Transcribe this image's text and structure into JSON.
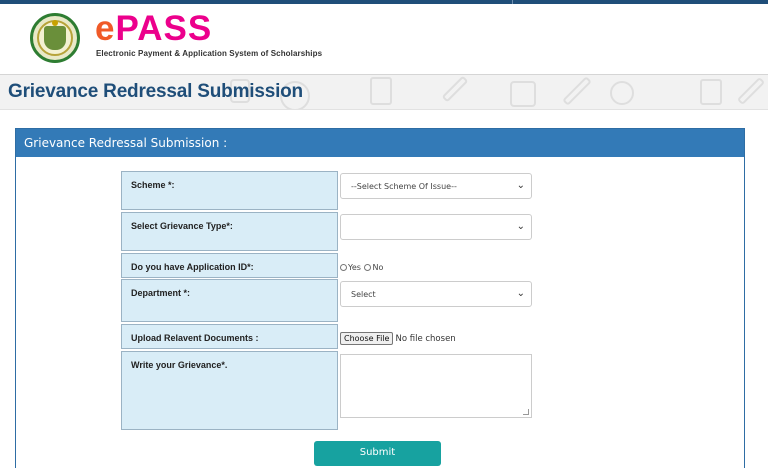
{
  "header": {
    "logo_e": "e",
    "logo_pass": "PASS",
    "logo_subtitle": "Electronic Payment & Application System of Scholarships"
  },
  "banner": {
    "title": "Grievance Redressal Submission"
  },
  "panel": {
    "heading": "Grievance Redressal Submission :"
  },
  "form": {
    "scheme_label": "Scheme *:",
    "scheme_selected": "--Select Scheme Of Issue--",
    "grievance_type_label": "Select Grievance Type*:",
    "grievance_type_selected": "",
    "application_id_label": "Do you have Application ID*:",
    "radio_yes": "Yes",
    "radio_no": "No",
    "department_label": "Department *:",
    "department_selected": "Select",
    "upload_label": "Upload Relavent Documents :",
    "choose_file_label": "Choose File",
    "no_file_text": "No file chosen",
    "grievance_label": "Write your Grievance*.",
    "grievance_value": "",
    "submit_label": "Submit"
  },
  "colors": {
    "brand_blue": "#1f4e79",
    "panel_header": "#337ab7",
    "label_bg": "#d9edf7",
    "submit_bg": "#17a2a0",
    "logo_e": "#f05a28",
    "logo_pass": "#ec008c"
  },
  "icons": [
    "telangana-emblem-icon",
    "chevron-down-icon",
    "resize-grip-icon"
  ]
}
